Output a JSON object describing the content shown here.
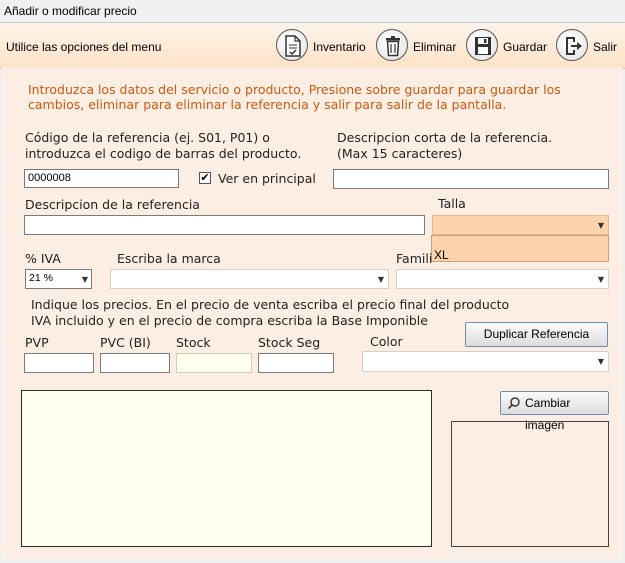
{
  "window": {
    "title": "Añadir o modificar precio"
  },
  "toolbar": {
    "hint": "Utilice las opciones del menu",
    "buttons": [
      {
        "label": "Inventario",
        "icon": "document-check-icon"
      },
      {
        "label": "Eliminar",
        "icon": "trash-icon"
      },
      {
        "label": "Guardar",
        "icon": "save-icon"
      },
      {
        "label": "Salir",
        "icon": "exit-icon"
      }
    ]
  },
  "form": {
    "intro_line1": "Introduzca los datos del servicio o producto, Presione sobre guardar para guardar los",
    "intro_line2": "cambios, eliminar para eliminar la referencia y salir para salir de la pantalla.",
    "codigo_label_line1": "Código de la referencia (ej. S01, P01) o",
    "codigo_label_line2": "introduzca el codigo de barras del producto.",
    "codigo_value": "0000008",
    "ver_principal_label": "Ver en principal",
    "ver_principal_checked": "✔",
    "desc_corta_label_line1": "Descripcion corta de la referencia.",
    "desc_corta_label_line2": "(Max 15 caracteres)",
    "desc_corta_value": "",
    "descripcion_label": "Descripcion de la referencia",
    "descripcion_value": "",
    "talla_label": "Talla",
    "talla_value": "",
    "talla_options": [
      "XL"
    ],
    "iva_label": "% IVA",
    "iva_value": "21 %",
    "marca_label": "Escriba la marca",
    "marca_value": "",
    "familia_label": "Famili",
    "familia_value": "",
    "precios_line1": "Indique los precios. En el precio de venta escriba el precio final del producto",
    "precios_line2": "IVA incluido y en el precio de compra escriba la Base Imponible",
    "duplicar_label": "Duplicar Referencia",
    "pvp_label": "PVP",
    "pvc_label": "PVC (BI)",
    "stock_label": "Stock",
    "stock_seg_label": "Stock Seg",
    "color_label": "Color",
    "pvp_value": "",
    "pvc_value": "",
    "stock_value": "",
    "stock_seg_value": "",
    "color_value": "",
    "cambiar_imagen_label": "Cambiar imagen"
  },
  "colors": {
    "panel": "#fdeee3",
    "intro_text": "#c85a10",
    "dropdown_highlight": "#fdd3ae",
    "notes_bg": "#fffff0"
  }
}
